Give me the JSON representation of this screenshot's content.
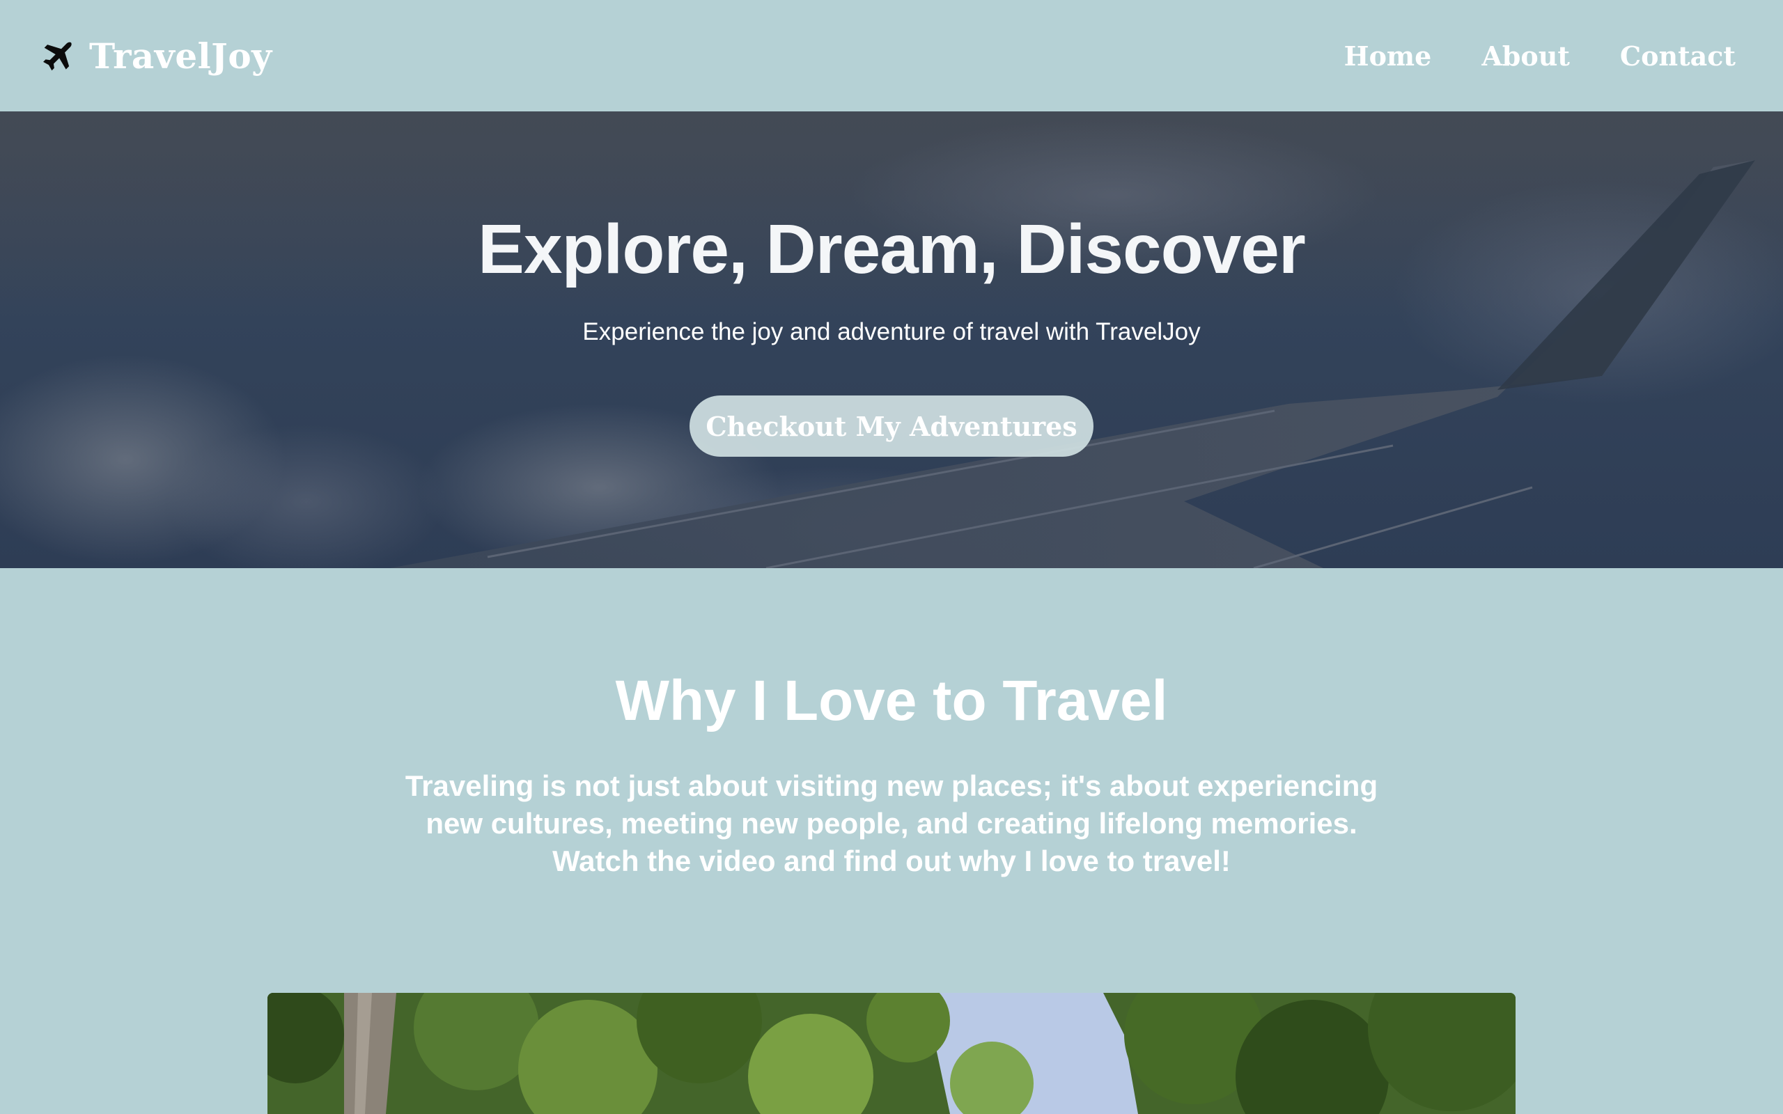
{
  "nav": {
    "brand": "TravelJoy",
    "brand_icon": "airplane-icon",
    "links": [
      "Home",
      "About",
      "Contact"
    ]
  },
  "hero": {
    "title": "Explore, Dream, Discover",
    "subtitle": "Experience the joy and adventure of travel with TravelJoy",
    "cta_label": "Checkout My Adventures",
    "background": "airplane-wing-sky-photo"
  },
  "section": {
    "title": "Why I Love to Travel",
    "text": "Traveling is not just about visiting new places; it's about experiencing new cultures, meeting new people, and creating lifelong memories. Watch the video and find out why I love to travel!"
  },
  "video": {
    "thumbnail": "forest-trees-video"
  },
  "colors": {
    "page_background": "#b5d1d5",
    "text": "#ffffff",
    "hero_overlay": "#33435a",
    "button": "#cfe0e2"
  }
}
